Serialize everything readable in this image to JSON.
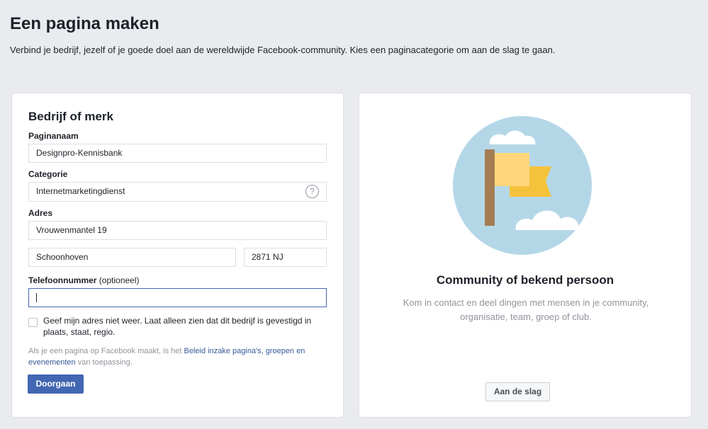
{
  "header": {
    "title": "Een pagina maken",
    "subtitle": "Verbind je bedrijf, jezelf of je goede doel aan de wereldwijde Facebook-community. Kies een paginacategorie om aan de slag te gaan."
  },
  "business_card": {
    "title": "Bedrijf of merk",
    "page_name": {
      "label": "Paginanaam",
      "value": "Designpro-Kennisbank"
    },
    "category": {
      "label": "Categorie",
      "value": "Internetmarketingdienst",
      "help_icon": "?"
    },
    "address": {
      "label": "Adres",
      "street": "Vrouwenmantel 19",
      "city": "Schoonhoven",
      "postal_code": "2871 NJ"
    },
    "phone": {
      "label": "Telefoonnummer",
      "optional": "(optioneel)",
      "value": ""
    },
    "hide_address_checkbox": {
      "checked": false,
      "text": "Geef mijn adres niet weer. Laat alleen zien dat dit bedrijf is gevestigd in plaats, staat, regio."
    },
    "policy": {
      "prefix": "Als je een pagina op Facebook maakt, is het ",
      "link": "Beleid inzake pagina's, groepen en evenementen",
      "suffix": " van toepassing."
    },
    "continue_button": "Doorgaan"
  },
  "community_card": {
    "title": "Community of bekend persoon",
    "description": "Kom in contact en deel dingen met mensen in je community, organisatie, team, groep of club.",
    "start_button": "Aan de slag",
    "illustration": "flag-illustration"
  },
  "colors": {
    "background": "#e9ebee",
    "primary": "#4267b2",
    "link": "#365899",
    "muted_text": "#90949c",
    "illustration_sky": "#b4d7e8",
    "flag_light": "#ffd77a",
    "flag_dark": "#f5c33b",
    "pole": "#a67c52"
  }
}
